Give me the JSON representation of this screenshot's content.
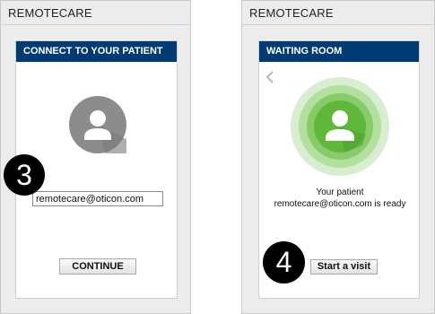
{
  "left_window": {
    "app_title": "REMOTECARE",
    "header": "CONNECT TO YOUR PATIENT",
    "email_value": "remotecare@oticon.com",
    "step_number": "3",
    "continue_label": "CONTINUE",
    "avatar_icon": "user-avatar-icon"
  },
  "right_window": {
    "app_title": "REMOTECARE",
    "header": "WAITING ROOM",
    "back_icon": "chevron-left-icon",
    "avatar_icon": "patient-ready-avatar-icon",
    "message_line1": "Your patient",
    "message_line2": "remotecare@oticon.com is ready",
    "step_number": "4",
    "start_visit_label": "Start a visit"
  },
  "colors": {
    "header_bg": "#003b73",
    "avatar_gray": "#8c8c8c",
    "avatar_green": "#5fb83a",
    "ring_light_green": "#c8e9bf",
    "badge_black": "#000000"
  }
}
